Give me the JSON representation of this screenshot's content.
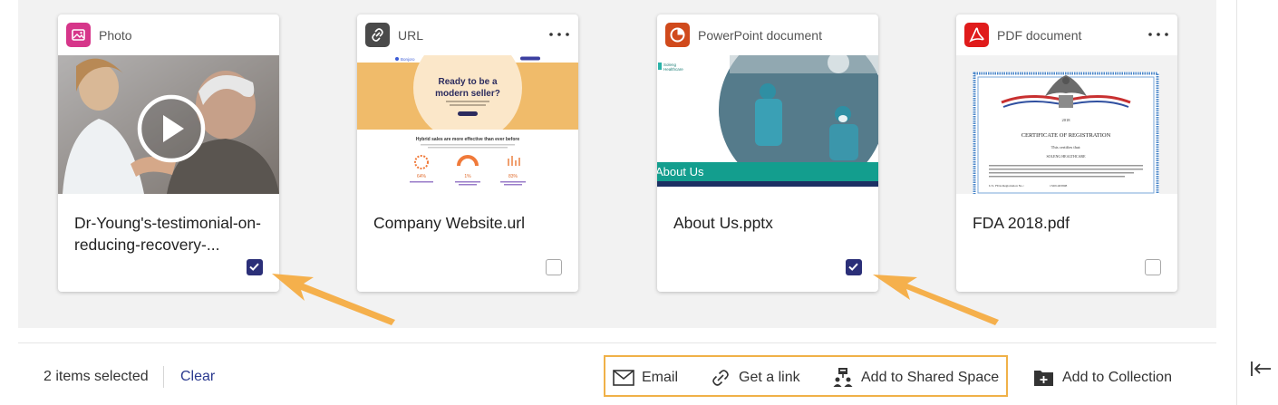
{
  "cards": [
    {
      "type_label": "Photo",
      "title": "Dr-Young's-testimonial-on-reducing-recovery-...",
      "checked": true,
      "badge_color": "#d6368a",
      "icon": "image-icon"
    },
    {
      "type_label": "URL",
      "title": "Company Website.url",
      "checked": false,
      "badge_color": "#4a4a4a",
      "icon": "link-icon"
    },
    {
      "type_label": "PowerPoint document",
      "title": "About Us.pptx",
      "checked": true,
      "badge_color": "#d04a1c",
      "icon": "powerpoint-icon"
    },
    {
      "type_label": "PDF document",
      "title": "FDA 2018.pdf",
      "checked": false,
      "badge_color": "#e01b1b",
      "icon": "pdf-icon"
    }
  ],
  "thumbs": {
    "website": {
      "logo": "Bonjoro",
      "headline_1": "Ready to be a",
      "headline_2": "modern seller?",
      "subhead": "Hybrid sales are more effective than ever before",
      "stats": [
        "64%",
        "1%",
        "83%"
      ]
    },
    "pptx": {
      "logo_line1": "Soleng",
      "logo_line2": "Healthcare",
      "banner": "About Us"
    },
    "pdf": {
      "year": "2018",
      "heading": "CERTIFICATE OF REGISTRATION",
      "line1": "This certifies that:",
      "line2": "SOLENG HEALTHCARE",
      "reg_label": "U.S. FDA Registration No.:",
      "reg_no": "13201463998"
    }
  },
  "bottom_bar": {
    "selected_count": "2 items selected",
    "clear_label": "Clear",
    "actions": {
      "email": "Email",
      "link": "Get a link",
      "shared_space": "Add to Shared Space",
      "collection": "Add to Collection"
    }
  },
  "colors": {
    "accent": "#2b2f78",
    "highlight": "#f0b148",
    "link": "#2b3a8f"
  }
}
